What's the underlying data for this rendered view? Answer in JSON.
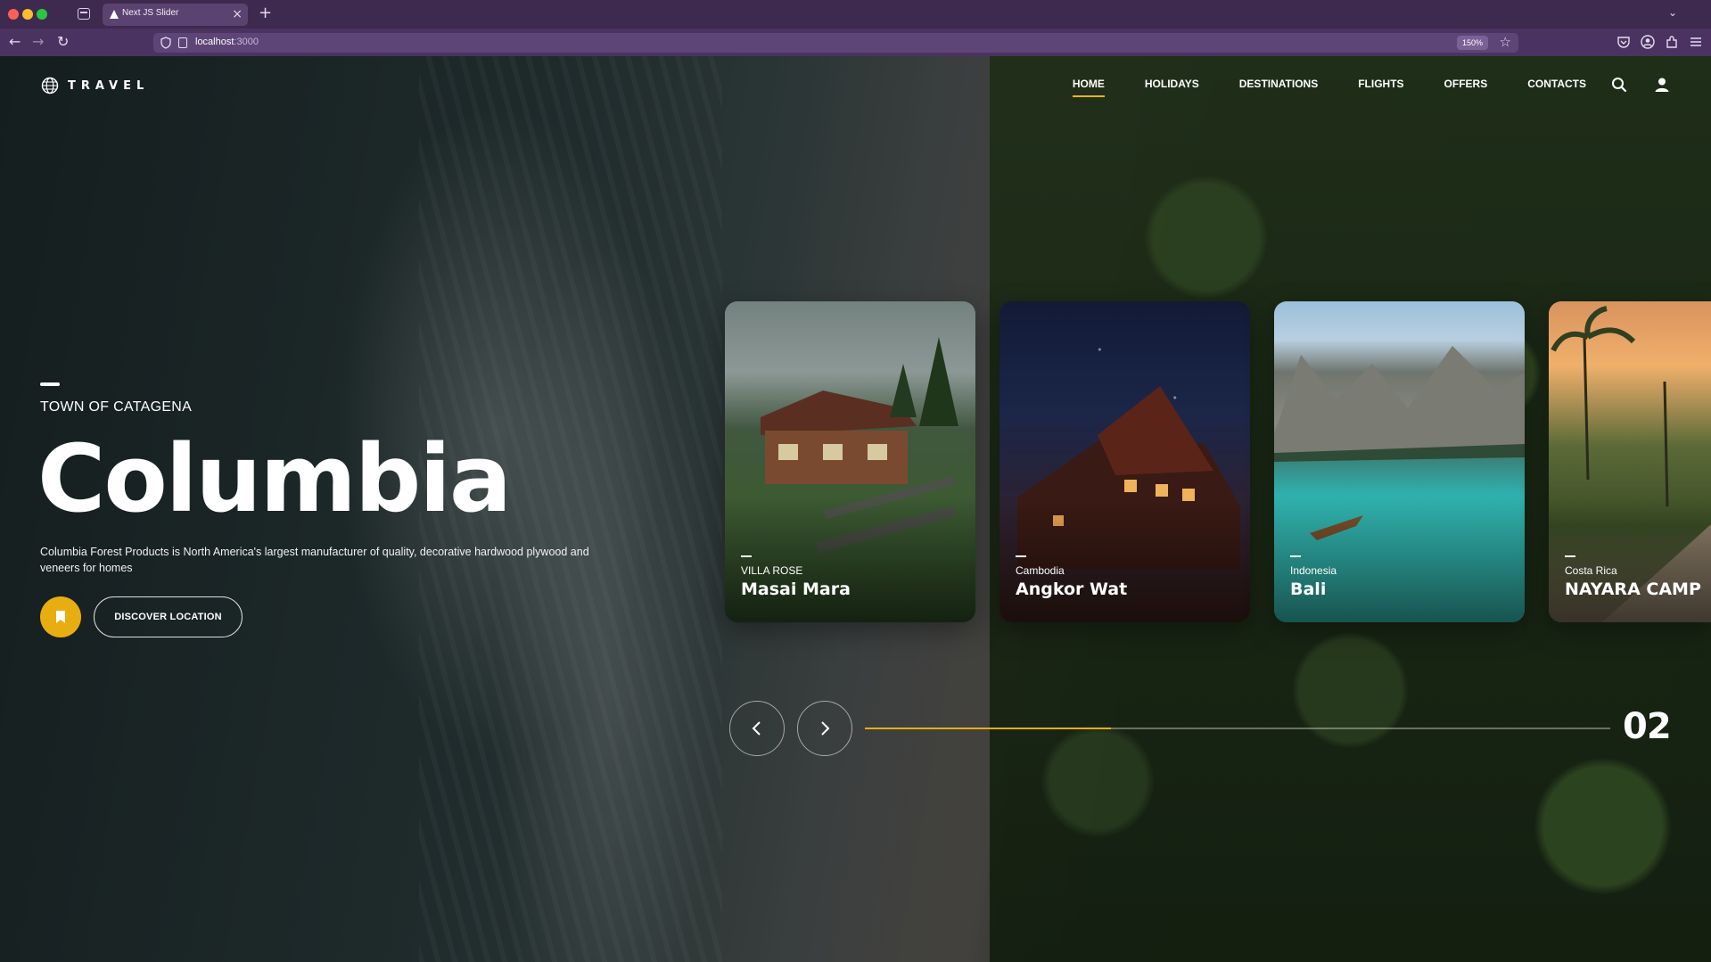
{
  "browser": {
    "tab_title": "Next JS Slider",
    "url_host": "localhost",
    "url_port": ":3000",
    "zoom": "150%"
  },
  "header": {
    "logo_text": "TRAVEL",
    "menu": [
      {
        "label": "HOME",
        "active": true
      },
      {
        "label": "HOLIDAYS"
      },
      {
        "label": "DESTINATIONS"
      },
      {
        "label": "FLIGHTS"
      },
      {
        "label": "OFFERS"
      },
      {
        "label": "CONTACTS"
      }
    ]
  },
  "hero": {
    "subtitle": "TOWN OF CATAGENA",
    "title": "Columbia",
    "description": "Columbia Forest Products is North America's largest manufacturer of quality, decorative hardwood plywood and veneers for homes",
    "discover_label": "DISCOVER LOCATION"
  },
  "cards": [
    {
      "subtitle": "VILLA ROSE",
      "title": "Masai Mara"
    },
    {
      "subtitle": "Cambodia",
      "title": "Angkor Wat"
    },
    {
      "subtitle": "Indonesia",
      "title": "Bali"
    },
    {
      "subtitle": "Costa Rica",
      "title": "NAYARA CAMP"
    }
  ],
  "slider": {
    "current_slide": "02",
    "progress_fraction": 0.33
  },
  "colors": {
    "accent": "#e8ad10",
    "browser_chrome": "#4b3361"
  },
  "icons": {
    "logo": "globe-icon",
    "search": "search-icon",
    "account": "user-icon",
    "bookmark": "bookmark-icon",
    "prev": "chevron-left-icon",
    "next": "chevron-right-icon"
  }
}
